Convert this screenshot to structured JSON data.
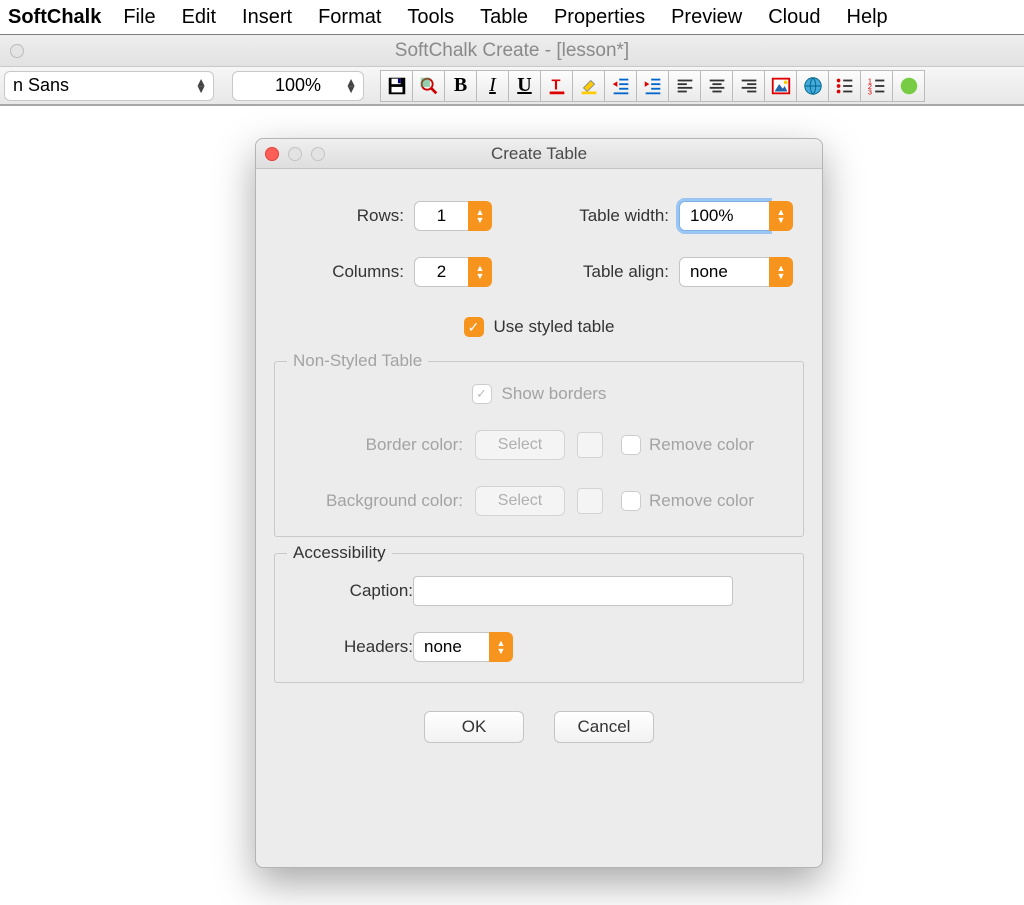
{
  "menubar": {
    "app": "SoftChalk",
    "items": [
      "File",
      "Edit",
      "Insert",
      "Format",
      "Tools",
      "Table",
      "Properties",
      "Preview",
      "Cloud",
      "Help"
    ]
  },
  "docbar": {
    "title": "SoftChalk Create - [lesson*]"
  },
  "toolbar": {
    "font": "n Sans",
    "zoom": "100%"
  },
  "dialog": {
    "title": "Create Table",
    "rows_label": "Rows:",
    "rows_value": "1",
    "cols_label": "Columns:",
    "cols_value": "2",
    "width_label": "Table width:",
    "width_value": "100%",
    "align_label": "Table align:",
    "align_value": "none",
    "styled_label": "Use styled table",
    "nonstyled": {
      "legend": "Non-Styled Table",
      "show_borders": "Show borders",
      "border_color": "Border color:",
      "bg_color": "Background color:",
      "select": "Select",
      "remove": "Remove color"
    },
    "accessibility": {
      "legend": "Accessibility",
      "caption": "Caption:",
      "headers": "Headers:",
      "headers_value": "none"
    },
    "ok": "OK",
    "cancel": "Cancel"
  }
}
